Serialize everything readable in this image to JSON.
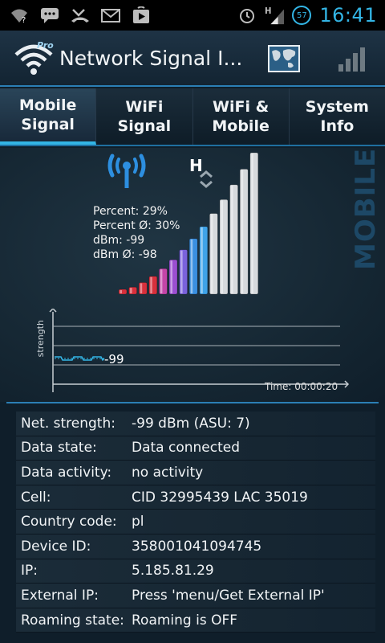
{
  "status_bar": {
    "icons_left": [
      "wifi-question-icon",
      "sms-icon",
      "missed-call-icon",
      "email-icon",
      "play-store-icon"
    ],
    "icons_right": [
      "alarm-icon",
      "hspa-signal-icon"
    ],
    "battery_level": "57",
    "time": "16:41"
  },
  "title_bar": {
    "app_badge": "Pro",
    "title": "Network Signal I..."
  },
  "tabs": [
    {
      "label": "Mobile\nSignal",
      "active": true
    },
    {
      "label": "WiFi\nSignal",
      "active": false
    },
    {
      "label": "WiFi &\nMobile",
      "active": false
    },
    {
      "label": "System\nInfo",
      "active": false
    }
  ],
  "signal": {
    "network_type": "H",
    "side_label": "MOBILE",
    "percent": "Percent: 29%",
    "percent_avg": "Percent Ø: 30%",
    "dbm": "dBm: -99",
    "dbm_avg": "dBm Ø: -98",
    "bars_total": 14,
    "bars_lit": 4
  },
  "graph": {
    "y_label": "strength",
    "current_value": "-99",
    "time": "Time: 00:00:20"
  },
  "info_rows": [
    {
      "label": "Net. strength:",
      "value": "-99 dBm (ASU: 7)"
    },
    {
      "label": "Data state:",
      "value": "Data connected"
    },
    {
      "label": "Data activity:",
      "value": "no activity"
    },
    {
      "label": "Cell:",
      "value": "CID 32995439 LAC 35019"
    },
    {
      "label": "Country code:",
      "value": "pl"
    },
    {
      "label": "Device ID:",
      "value": "358001041094745"
    },
    {
      "label": "IP:",
      "value": "5.185.81.29"
    },
    {
      "label": "External IP:",
      "value": "Press 'menu/Get External IP'"
    },
    {
      "label": "Roaming state:",
      "value": "Roaming is OFF"
    }
  ],
  "colors": {
    "accent": "#33b5e5",
    "bar_red": "#d8303c",
    "bar_purple": "#9b4fd1",
    "bar_blue": "#3a8fe0"
  }
}
